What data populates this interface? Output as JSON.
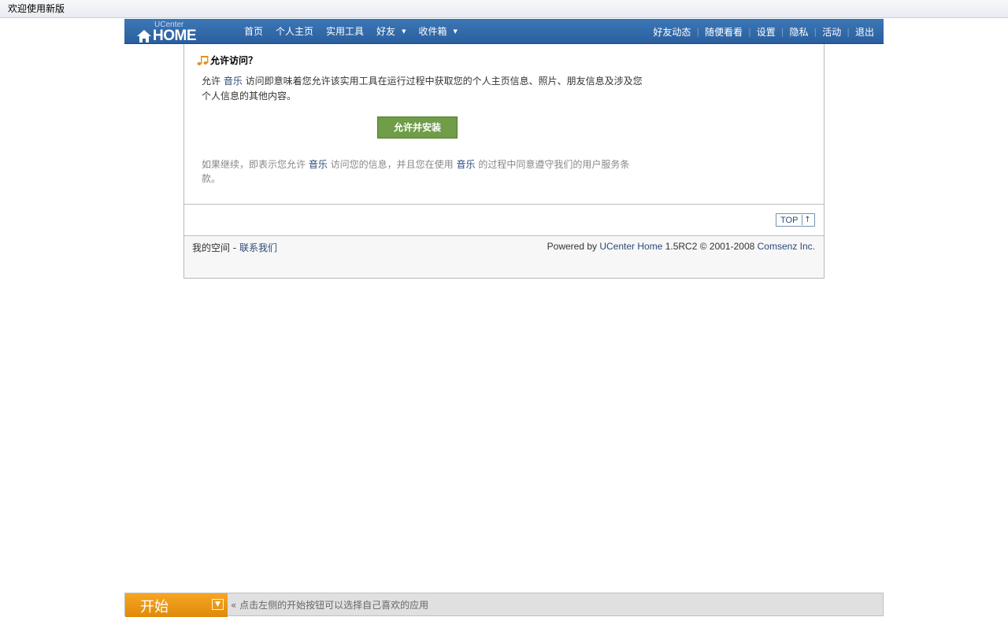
{
  "browser": {
    "title": "欢迎使用新版"
  },
  "header": {
    "logo_small": "UCenter",
    "logo_big": "HOME",
    "nav": [
      {
        "label": "首页",
        "dropdown": false
      },
      {
        "label": "个人主页",
        "dropdown": false
      },
      {
        "label": "实用工具",
        "dropdown": false
      },
      {
        "label": "好友",
        "dropdown": true
      },
      {
        "label": "收件箱",
        "dropdown": true
      }
    ],
    "right_nav": [
      "好友动态",
      "随便看看",
      "设置",
      "隐私",
      "活动",
      "退出"
    ]
  },
  "main": {
    "title": "允许访问？",
    "desc_prefix": "允许 ",
    "app_name": "音乐",
    "desc_suffix": " 访问即意味着您允许该实用工具在运行过程中获取您的个人主页信息、照片、朋友信息及涉及您个人信息的其他内容。",
    "allow_button": "允许并安装",
    "notice_prefix": "如果继续，即表示您允许 ",
    "notice_mid": " 访问您的信息，并且您在使用 ",
    "notice_suffix": " 的过程中同意遵守我们的用户服务条款。",
    "top_button": "TOP"
  },
  "footer": {
    "my_space": "我的空间",
    "dash": " - ",
    "contact": "联系我们",
    "powered_by": "Powered by ",
    "product": "UCenter Home",
    "version": " 1.5RC2 © 2001-2008 ",
    "company": "Comsenz Inc."
  },
  "dock": {
    "start_label": "开始",
    "hint": "« 点击左侧的开始按钮可以选择自己喜欢的应用"
  },
  "colors": {
    "header": "#2f67a8",
    "accent_link": "#2b4a78",
    "allow_button": "#6f9d48",
    "start_button": "#f0981a"
  }
}
